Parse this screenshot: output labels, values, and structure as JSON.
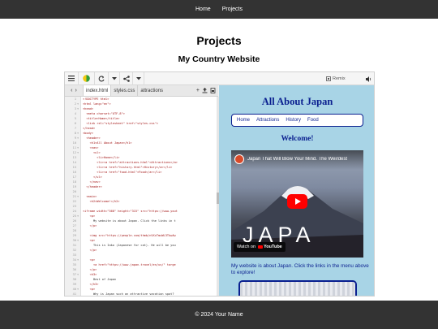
{
  "nav": {
    "items": [
      "Home",
      "Projects"
    ]
  },
  "page_title": "Projects",
  "project_title": "My Country Website",
  "editor": {
    "tabs": [
      "index.html",
      "styles.css",
      "attractions"
    ],
    "remix_label": "Remix",
    "icons": [
      "menu-icon",
      "theme-icon",
      "refresh-icon",
      "dropdown-icon",
      "share-icon",
      "fullscreen-icon"
    ],
    "code_lines": [
      {
        "n": "1",
        "f": "",
        "t": "<!DOCTYPE html>"
      },
      {
        "n": "2",
        "f": "▾",
        "t": "<html lang=\"en\">"
      },
      {
        "n": "3",
        "f": "▾",
        "t": "<head>"
      },
      {
        "n": "4",
        "f": "",
        "t": "  <meta charset=\"UTF-8\">"
      },
      {
        "n": "5",
        "f": "",
        "t": "  <title>Home</title>"
      },
      {
        "n": "6",
        "f": "",
        "t": "  <link rel=\"stylesheet\" href=\"styles.css\">"
      },
      {
        "n": "7",
        "f": "",
        "t": "</head>"
      },
      {
        "n": "8",
        "f": "▾",
        "t": "<body>"
      },
      {
        "n": "9",
        "f": "▾",
        "t": "  <header>"
      },
      {
        "n": "10",
        "f": "",
        "t": "    <h1>All About Japan</h1>"
      },
      {
        "n": "11",
        "f": "▾",
        "t": "    <nav>"
      },
      {
        "n": "12",
        "f": "▾",
        "t": "      <ul>"
      },
      {
        "n": "13",
        "f": "",
        "t": "        <li>Home</li>"
      },
      {
        "n": "14",
        "f": "",
        "t": "        <li><a href=\"attractions.html\">Attractions</a>"
      },
      {
        "n": "15",
        "f": "",
        "t": "        <li><a href=\"history.html\">History</a></li>"
      },
      {
        "n": "16",
        "f": "",
        "t": "        <li><a href=\"food.html\">Food</a></li>"
      },
      {
        "n": "17",
        "f": "",
        "t": "      </ul>"
      },
      {
        "n": "18",
        "f": "",
        "t": "    </nav>"
      },
      {
        "n": "19",
        "f": "",
        "t": "  </header>"
      },
      {
        "n": "20",
        "f": "",
        "t": ""
      },
      {
        "n": "21",
        "f": "▾",
        "t": "  <main>"
      },
      {
        "n": "22",
        "f": "",
        "t": "    <h2>Welcome!</h2>"
      },
      {
        "n": "23",
        "f": "",
        "t": ""
      },
      {
        "n": "24",
        "f": "",
        "t": "<iframe width=\"560\" height=\"315\" src=\"https://www.yout"
      },
      {
        "n": "25",
        "f": "▾",
        "t": "    <p>"
      },
      {
        "n": "26",
        "f": "",
        "t": "      My website is about Japan. Click the links in t"
      },
      {
        "n": "27",
        "f": "",
        "t": "    </p>"
      },
      {
        "n": "28",
        "f": "",
        "t": ""
      },
      {
        "n": "29",
        "f": "",
        "t": "    <img src=\"https://people.com/thmb/nVXxTmuWL3TkwAw"
      },
      {
        "n": "30",
        "f": "▾",
        "t": "    <p>"
      },
      {
        "n": "31",
        "f": "",
        "t": "      This is Iako (Japanese for cat). He will be you"
      },
      {
        "n": "32",
        "f": "",
        "t": "    </p>"
      },
      {
        "n": "33",
        "f": "",
        "t": ""
      },
      {
        "n": "34",
        "f": "▾",
        "t": "    <p>"
      },
      {
        "n": "35",
        "f": "",
        "t": "      <a href=\"https://www.japan.travel/en/us/\" targe"
      },
      {
        "n": "36",
        "f": "",
        "t": "    </p>"
      },
      {
        "n": "37",
        "f": "▾",
        "t": "    <h3>"
      },
      {
        "n": "38",
        "f": "",
        "t": "      Best of Japan"
      },
      {
        "n": "39",
        "f": "",
        "t": "    </h3>"
      },
      {
        "n": "40",
        "f": "▾",
        "t": "    <p>"
      },
      {
        "n": "41",
        "f": "",
        "t": "      Why is Japan such an attractive vacation spot?"
      }
    ]
  },
  "preview": {
    "heading": "All About Japan",
    "nav": [
      "Home",
      "Attractions",
      "History",
      "Food"
    ],
    "welcome": "Welcome!",
    "video_title": "Japan That Will Blow Your Mind. The Weirdest",
    "video_overlay_text": "JAPA",
    "watch_on": "Watch on",
    "youtube": "YouTube",
    "paragraph": "My website is about Japan. Click the links in the menu above to explore!"
  },
  "footer": "© 2024 Your Name",
  "colors": {
    "dark": "#333333",
    "preview_bg": "#a8d4e6",
    "preview_accent": "#0a1f8f",
    "play_red": "#ff0000"
  }
}
